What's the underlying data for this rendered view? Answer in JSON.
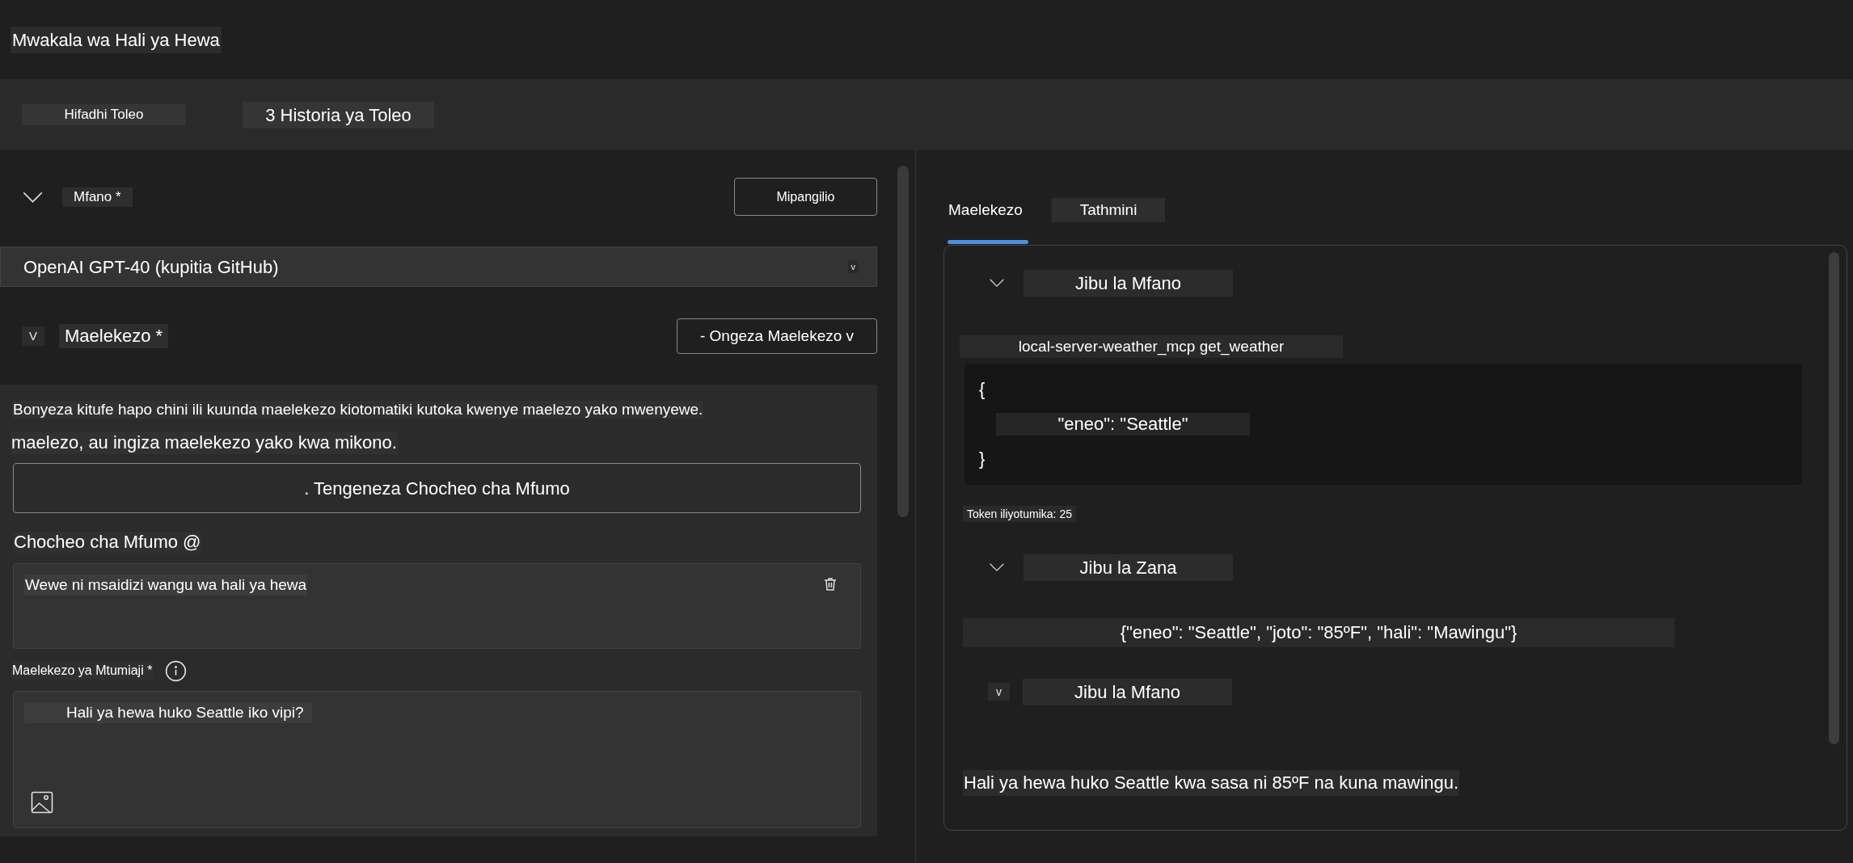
{
  "window": {
    "title": "Mwakala wa Hali ya Hewa"
  },
  "toolbar": {
    "save_version": "Hifadhi Toleo",
    "version_history": "3 Historia ya Toleo"
  },
  "model_section": {
    "label": "Mfano *",
    "settings_button": "Mipangilio",
    "model_dropdown": {
      "value": "OpenAI GPT-40 (kupitia GitHub)",
      "caret": "v"
    }
  },
  "instructions_section": {
    "toggle": "V",
    "label": "Maelekezo *",
    "add_button": "- Ongeza Maelekezo v",
    "hint_lines": [
      "Bonyeza kitufe hapo chini ili kuunda maelekezo kiotomatiki kutoka kwenye maelezo yako mwenyewe.",
      "maelezo, au ingiza maelekezo yako kwa mikono."
    ],
    "generate_button": ". Tengeneza Chocheo cha Mfumo",
    "system_prompt": {
      "label": "Chocheo cha Mfumo @",
      "value": "Wewe ni msaidizi wangu wa hali ya hewa"
    },
    "user_prompt": {
      "label": "Maelekezo ya Mtumiaji *",
      "value": "Hali ya hewa huko Seattle iko vipi?"
    }
  },
  "tabs": [
    {
      "label": "Maelekezo",
      "selected": true
    },
    {
      "label": "Tathmini",
      "selected": false
    }
  ],
  "response_panel": {
    "items": [
      {
        "kind": "section_header",
        "title": "Jibu la Mfano"
      },
      {
        "kind": "tool_name",
        "text": "local-server-weather_mcp get_weather"
      },
      {
        "kind": "code",
        "lines": [
          "{",
          "\"eneo\": \"Seattle\"",
          "}"
        ]
      },
      {
        "kind": "token_count",
        "text": "Token iliyotumika: 25"
      },
      {
        "kind": "section_header",
        "title": "Jibu la Zana"
      },
      {
        "kind": "tool_result",
        "text": "{\"eneo\": \"Seattle\", \"joto\": \"85ºF\", \"hali\": \"Mawingu\"}"
      },
      {
        "kind": "section_header",
        "toggle": "v",
        "title": "Jibu la Mfano"
      },
      {
        "kind": "message",
        "text": "Hali ya hewa huko Seattle kwa sasa ni 85ºF na kuna mawingu."
      }
    ]
  }
}
